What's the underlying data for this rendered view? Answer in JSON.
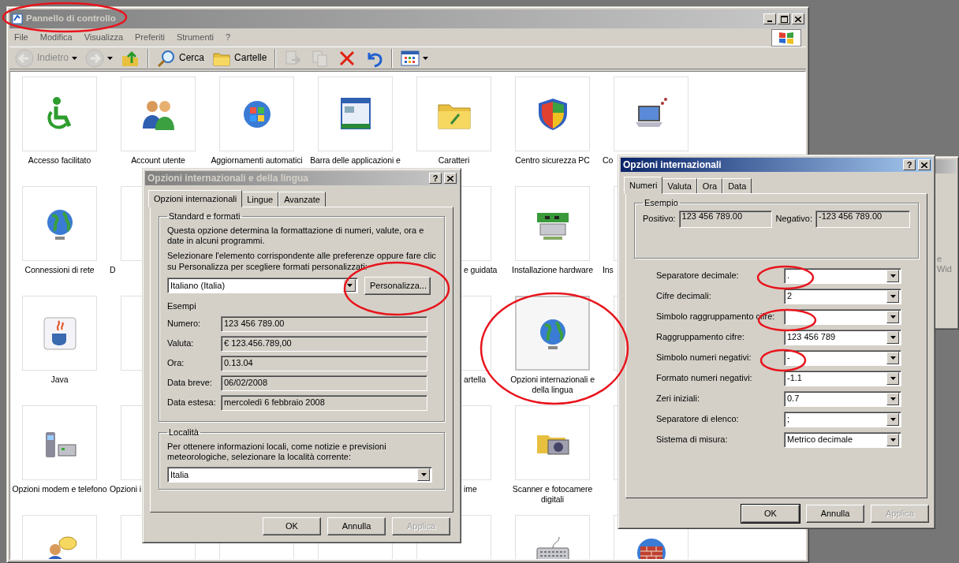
{
  "desktop": {
    "background_window": {
      "text": "e Wid"
    }
  },
  "control_panel": {
    "title": "Pannello di controllo",
    "active": false,
    "menu": [
      "File",
      "Modifica",
      "Visualizza",
      "Preferiti",
      "Strumenti",
      "?"
    ],
    "toolbar": [
      {
        "kind": "back",
        "label": "Indietro",
        "disabled": true
      },
      {
        "kind": "forward",
        "disabled": true
      },
      {
        "kind": "up",
        "disabled": false
      },
      {
        "kind": "search",
        "label": "Cerca",
        "disabled": false
      },
      {
        "kind": "folders",
        "label": "Cartelle",
        "disabled": false
      },
      {
        "kind": "move",
        "disabled": true
      },
      {
        "kind": "copy",
        "disabled": true
      },
      {
        "kind": "delete",
        "disabled": false
      },
      {
        "kind": "undo",
        "disabled": false
      },
      {
        "kind": "views",
        "disabled": false
      }
    ],
    "items": [
      {
        "kind": "item",
        "label": "Accesso facilitato",
        "selected": false
      },
      {
        "kind": "item",
        "label": "Account utente",
        "selected": false
      },
      {
        "kind": "item",
        "label": "Aggiornamenti automatici",
        "selected": false
      },
      {
        "kind": "item",
        "label": "Barra delle applicazioni e",
        "selected": false
      },
      {
        "kind": "item",
        "label": "Caratteri",
        "selected": false
      },
      {
        "kind": "item",
        "label": "Centro sicurezza PC",
        "selected": false
      },
      {
        "kind": "item",
        "label": "Co",
        "selected": false
      },
      {
        "kind": "item",
        "label": "Connessioni di rete",
        "selected": false
      },
      {
        "kind": "item",
        "label": "D",
        "selected": false
      },
      {
        "kind": "covered"
      },
      {
        "kind": "covered"
      },
      {
        "kind": "item",
        "label": "e guidata",
        "selected": false
      },
      {
        "kind": "item",
        "label": "Installazione hardware",
        "selected": false
      },
      {
        "kind": "item",
        "label": "Ins",
        "selected": false
      },
      {
        "kind": "item",
        "label": "Java",
        "selected": false
      },
      {
        "kind": "tile"
      },
      {
        "kind": "covered"
      },
      {
        "kind": "covered"
      },
      {
        "kind": "item",
        "label": "artella",
        "selected": false
      },
      {
        "kind": "item",
        "label": "Opzioni internazionali e della lingua",
        "selected": true
      },
      {
        "kind": "tile"
      },
      {
        "kind": "item",
        "label": "Opzioni modem e telefono",
        "selected": false
      },
      {
        "kind": "item",
        "label": "Opzioni i",
        "selected": false
      },
      {
        "kind": "covered"
      },
      {
        "kind": "covered"
      },
      {
        "kind": "item",
        "label": "ime",
        "selected": false
      },
      {
        "kind": "item",
        "label": "Scanner e fotocamere digitali",
        "selected": false
      },
      {
        "kind": "tile"
      },
      {
        "kind": "tile"
      },
      {
        "kind": "tile"
      },
      {
        "kind": "tile"
      },
      {
        "kind": "tile"
      },
      {
        "kind": "tile"
      },
      {
        "kind": "tile"
      },
      {
        "kind": "tile"
      }
    ]
  },
  "language_dialog": {
    "title": "Opzioni internazionali e della lingua",
    "active": false,
    "help_button": "?",
    "tabs": [
      {
        "label": "Opzioni internazionali",
        "selected": true
      },
      {
        "label": "Lingue",
        "selected": false
      },
      {
        "label": "Avanzate",
        "selected": false
      }
    ],
    "standard": {
      "legend": "Standard e formati",
      "description": "Questa opzione determina la formattazione di numeri, valute, ora e date in alcuni programmi.",
      "instruction": "Selezionare l'elemento corrispondente alle preferenze oppure fare clic su Personalizza per scegliere formati personalizzati:",
      "format": "Italiano (Italia)",
      "customize_button": "Personalizza...",
      "examples_label": "Esempi",
      "examples": [
        {
          "label": "Numero:",
          "value": "123 456 789.00"
        },
        {
          "label": "Valuta:",
          "value": "€ 123.456.789,00"
        },
        {
          "label": "Ora:",
          "value": "0.13.04"
        },
        {
          "label": "Data breve:",
          "value": "06/02/2008"
        },
        {
          "label": "Data estesa:",
          "value": "mercoledì 6 febbraio 2008"
        }
      ]
    },
    "location": {
      "legend": "Località",
      "description": "Per ottenere informazioni locali, come notizie e previsioni meteorologiche, selezionare la località corrente:",
      "value": "Italia"
    },
    "buttons": [
      {
        "label": "OK",
        "default": false,
        "disabled": false
      },
      {
        "label": "Annulla",
        "default": false,
        "disabled": false
      },
      {
        "label": "Applica",
        "default": false,
        "disabled": true
      }
    ]
  },
  "numbers_dialog": {
    "title": "Opzioni internazionali",
    "active": true,
    "help_button": "?",
    "tabs": [
      {
        "label": "Numeri",
        "selected": true
      },
      {
        "label": "Valuta",
        "selected": false
      },
      {
        "label": "Ora",
        "selected": false
      },
      {
        "label": "Data",
        "selected": false
      }
    ],
    "sample": {
      "legend": "Esempio",
      "positive_label": "Positivo:",
      "positive": "123 456 789.00",
      "negative_label": "Negativo:",
      "negative": "-123 456 789.00"
    },
    "settings": [
      {
        "label": "Separatore decimale:",
        "value": "."
      },
      {
        "label": "Cifre decimali:",
        "value": "2"
      },
      {
        "label": "Simbolo raggruppamento cifre:"
      },
      {
        "label": "Raggruppamento cifre:",
        "value": "123 456 789"
      },
      {
        "label": "Simbolo numeri negativi:",
        "value": "-"
      },
      {
        "label": "Formato numeri negativi:",
        "value": "-1.1"
      },
      {
        "label": "Zeri iniziali:",
        "value": "0.7"
      },
      {
        "label": "Separatore di elenco:",
        "value": ";"
      },
      {
        "label": "Sistema di misura:",
        "value": "Metrico decimale"
      }
    ],
    "buttons": [
      {
        "label": "OK",
        "default": true,
        "disabled": false
      },
      {
        "label": "Annulla",
        "default": false,
        "disabled": false
      },
      {
        "label": "Applica",
        "default": false,
        "disabled": true
      }
    ]
  }
}
